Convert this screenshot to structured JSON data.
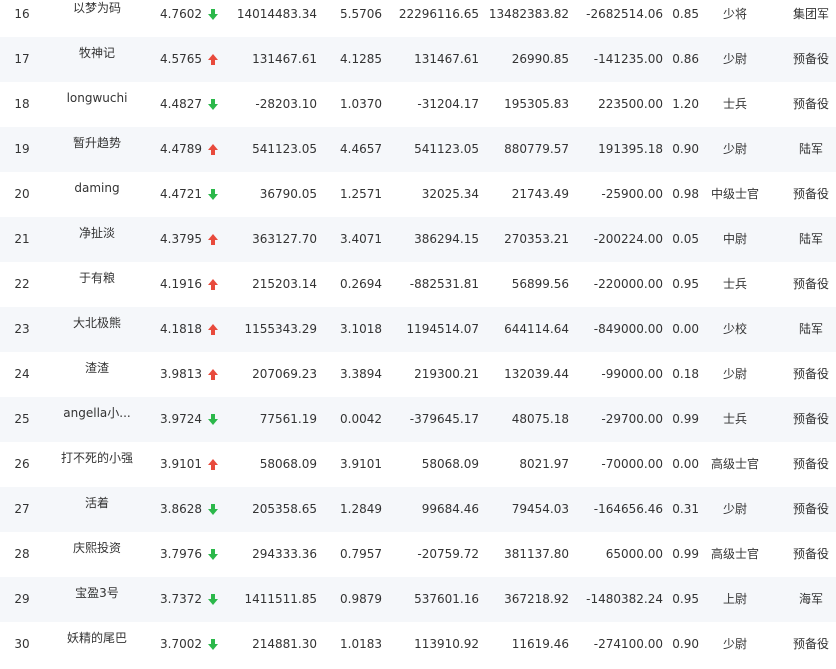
{
  "colors": {
    "up_arrow": "#e84a3c",
    "down_arrow": "#2bb84a",
    "row_alt_bg": "#f5f7fa",
    "text": "#333333"
  },
  "rows": [
    {
      "rank": "16",
      "name": "以梦为码",
      "score": "4.7602",
      "trend": "down",
      "v1": "14014483.34",
      "v2": "5.5706",
      "v3": "22296116.65",
      "v4": "13482383.82",
      "v5": "-2682514.06",
      "v6": "0.85",
      "rank_name": "少将",
      "unit": "集团军"
    },
    {
      "rank": "17",
      "name": "牧神记",
      "score": "4.5765",
      "trend": "up",
      "v1": "131467.61",
      "v2": "4.1285",
      "v3": "131467.61",
      "v4": "26990.85",
      "v5": "-141235.00",
      "v6": "0.86",
      "rank_name": "少尉",
      "unit": "预备役"
    },
    {
      "rank": "18",
      "name": "longwuchi",
      "score": "4.4827",
      "trend": "down",
      "v1": "-28203.10",
      "v2": "1.0370",
      "v3": "-31204.17",
      "v4": "195305.83",
      "v5": "223500.00",
      "v6": "1.20",
      "rank_name": "士兵",
      "unit": "预备役"
    },
    {
      "rank": "19",
      "name": "暂升趋势",
      "score": "4.4789",
      "trend": "up",
      "v1": "541123.05",
      "v2": "4.4657",
      "v3": "541123.05",
      "v4": "880779.57",
      "v5": "191395.18",
      "v6": "0.90",
      "rank_name": "少尉",
      "unit": "陆军"
    },
    {
      "rank": "20",
      "name": "daming",
      "score": "4.4721",
      "trend": "down",
      "v1": "36790.05",
      "v2": "1.2571",
      "v3": "32025.34",
      "v4": "21743.49",
      "v5": "-25900.00",
      "v6": "0.98",
      "rank_name": "中级士官",
      "unit": "预备役"
    },
    {
      "rank": "21",
      "name": "净扯淡",
      "score": "4.3795",
      "trend": "up",
      "v1": "363127.70",
      "v2": "3.4071",
      "v3": "386294.15",
      "v4": "270353.21",
      "v5": "-200224.00",
      "v6": "0.05",
      "rank_name": "中尉",
      "unit": "陆军"
    },
    {
      "rank": "22",
      "name": "于有粮",
      "score": "4.1916",
      "trend": "up",
      "v1": "215203.14",
      "v2": "0.2694",
      "v3": "-882531.81",
      "v4": "56899.56",
      "v5": "-220000.00",
      "v6": "0.95",
      "rank_name": "士兵",
      "unit": "预备役"
    },
    {
      "rank": "23",
      "name": "大北极熊",
      "score": "4.1818",
      "trend": "up",
      "v1": "1155343.29",
      "v2": "3.1018",
      "v3": "1194514.07",
      "v4": "644114.64",
      "v5": "-849000.00",
      "v6": "0.00",
      "rank_name": "少校",
      "unit": "陆军"
    },
    {
      "rank": "24",
      "name": "渣渣",
      "score": "3.9813",
      "trend": "up",
      "v1": "207069.23",
      "v2": "3.3894",
      "v3": "219300.21",
      "v4": "132039.44",
      "v5": "-99000.00",
      "v6": "0.18",
      "rank_name": "少尉",
      "unit": "预备役"
    },
    {
      "rank": "25",
      "name": "angella小...",
      "score": "3.9724",
      "trend": "down",
      "v1": "77561.19",
      "v2": "0.0042",
      "v3": "-379645.17",
      "v4": "48075.18",
      "v5": "-29700.00",
      "v6": "0.99",
      "rank_name": "士兵",
      "unit": "预备役"
    },
    {
      "rank": "26",
      "name": "打不死的小强",
      "score": "3.9101",
      "trend": "up",
      "v1": "58068.09",
      "v2": "3.9101",
      "v3": "58068.09",
      "v4": "8021.97",
      "v5": "-70000.00",
      "v6": "0.00",
      "rank_name": "高级士官",
      "unit": "预备役"
    },
    {
      "rank": "27",
      "name": "活着",
      "score": "3.8628",
      "trend": "down",
      "v1": "205358.65",
      "v2": "1.2849",
      "v3": "99684.46",
      "v4": "79454.03",
      "v5": "-164656.46",
      "v6": "0.31",
      "rank_name": "少尉",
      "unit": "预备役"
    },
    {
      "rank": "28",
      "name": "庆熙投资",
      "score": "3.7976",
      "trend": "down",
      "v1": "294333.36",
      "v2": "0.7957",
      "v3": "-20759.72",
      "v4": "381137.80",
      "v5": "65000.00",
      "v6": "0.99",
      "rank_name": "高级士官",
      "unit": "预备役"
    },
    {
      "rank": "29",
      "name": "宝盈3号",
      "score": "3.7372",
      "trend": "down",
      "v1": "1411511.85",
      "v2": "0.9879",
      "v3": "537601.16",
      "v4": "367218.92",
      "v5": "-1480382.24",
      "v6": "0.95",
      "rank_name": "上尉",
      "unit": "海军"
    },
    {
      "rank": "30",
      "name": "妖精的尾巴",
      "score": "3.7002",
      "trend": "down",
      "v1": "214881.30",
      "v2": "1.0183",
      "v3": "113910.92",
      "v4": "11619.46",
      "v5": "-274100.00",
      "v6": "0.90",
      "rank_name": "少尉",
      "unit": "预备役"
    }
  ]
}
